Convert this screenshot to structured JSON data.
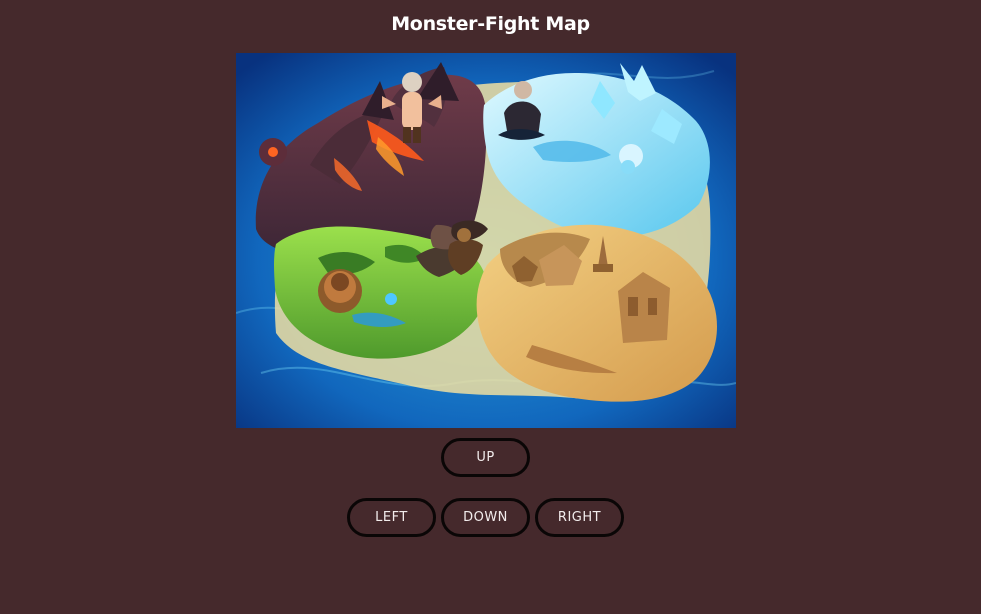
{
  "page": {
    "title": "Monster-Fight Map"
  },
  "map": {
    "image_name": "fantasy-island-map",
    "regions": [
      "volcano",
      "ice",
      "forest",
      "desert"
    ],
    "colors": {
      "ocean": "#0d4ea3",
      "lava": "#ff5a1c",
      "ice": "#8ee6ff",
      "grass": "#72c43a",
      "sand": "#e5b760"
    }
  },
  "controls": {
    "up_label": "UP",
    "left_label": "LEFT",
    "down_label": "DOWN",
    "right_label": "RIGHT"
  },
  "colors": {
    "background": "#45292c",
    "button_border": "#0a0606",
    "text": "#ffffff"
  }
}
